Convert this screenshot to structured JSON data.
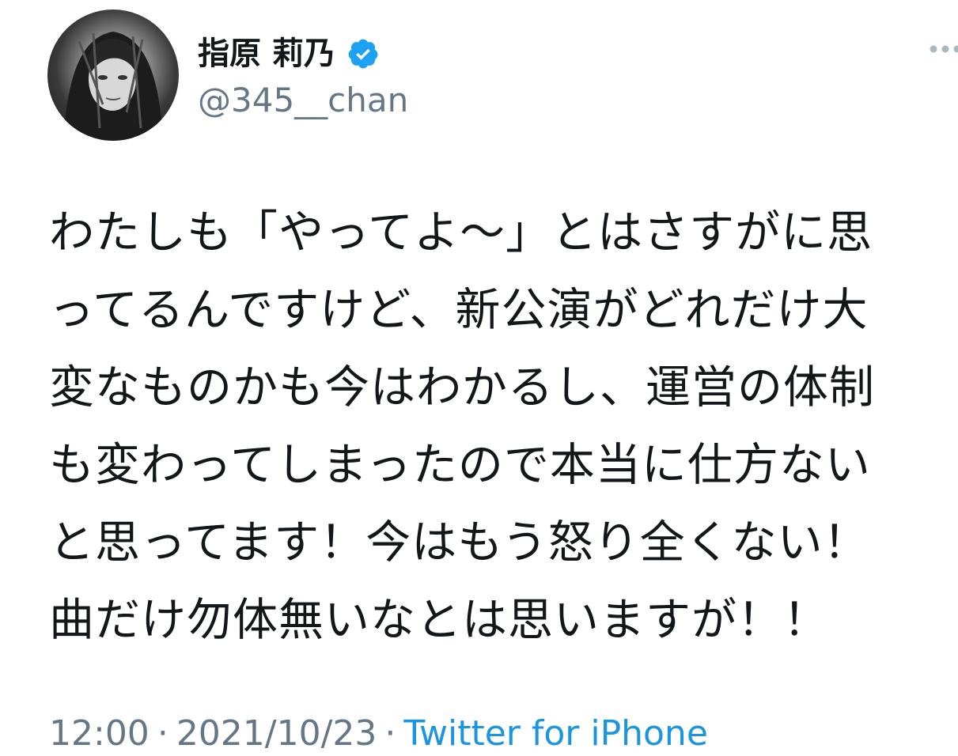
{
  "profile": {
    "display_name": "指原 莉乃",
    "handle": "@345__chan",
    "avatar_icon": "profile-photo",
    "verified_icon": "verified-badge-icon",
    "verified_color": "#1da1f2"
  },
  "tweet": {
    "lines": [
      "わたしも「やってよ〜」とはさすがに思",
      "ってるんですけど、新公演がどれだけ大",
      "変なものかも今はわかるし、運営の体制",
      "も変わってしまったので本当に仕方ない",
      "と思ってます！今はもう怒り全くない！",
      "曲だけ勿体無いなとは思いますが！！"
    ]
  },
  "meta": {
    "time": "12:00",
    "separator": "·",
    "date": "2021/10/23",
    "source": "Twitter for iPhone",
    "source_color": "#1b95e0"
  },
  "more_icon": "more-options-icon"
}
